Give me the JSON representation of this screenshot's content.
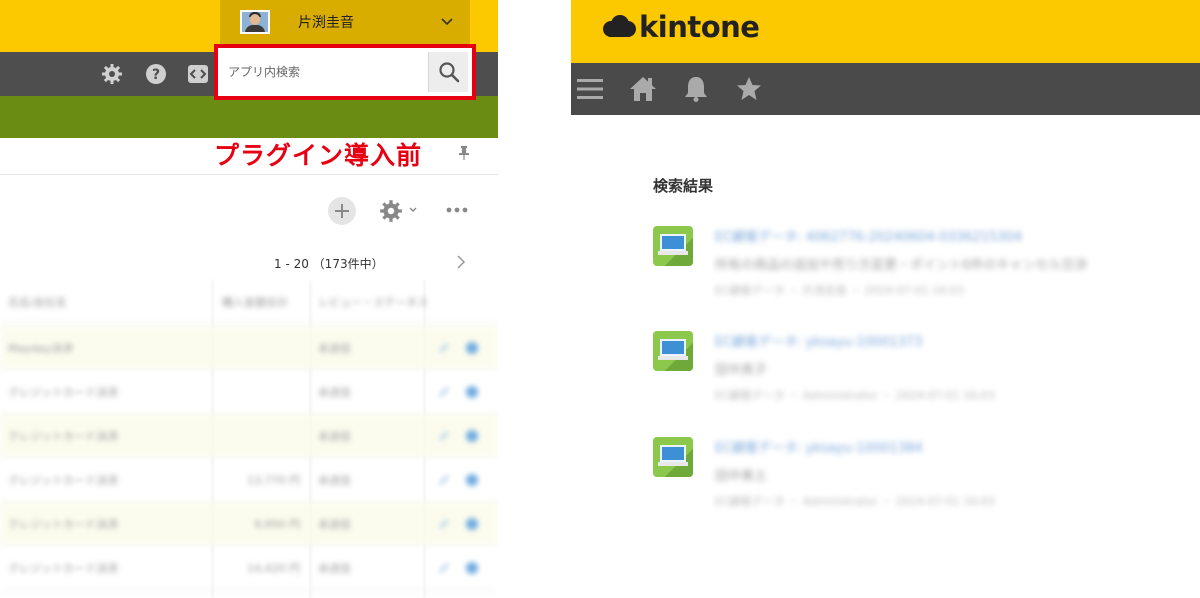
{
  "left_app": {
    "user": {
      "name": "片渕圭音"
    },
    "search": {
      "placeholder": "アプリ内検索"
    },
    "annotation": {
      "label": "プラグイン導入前"
    },
    "toolbar": {
      "pager": "1 - 20 （173件中）"
    },
    "table": {
      "headers": [
        "氏名/会社名",
        "購入金額合計",
        "レビュー・ステータス"
      ],
      "rows": [
        {
          "name": "Mayday決済",
          "amount": "",
          "status": "未送信"
        },
        {
          "name": "クレジットカード決済",
          "amount": "",
          "status": "未送信"
        },
        {
          "name": "クレジットカード決済",
          "amount": "",
          "status": "未送信"
        },
        {
          "name": "クレジットカード決済",
          "amount": "13,770 円",
          "status": "未送信"
        },
        {
          "name": "クレジットカード決済",
          "amount": "9,950 円",
          "status": "未送信"
        },
        {
          "name": "クレジットカード決済",
          "amount": "14,420 円",
          "status": "未送信"
        }
      ]
    },
    "colors": {
      "header_yellow": "#fcc800",
      "user_bar": "#d9ad00",
      "toolbar_gray": "#4e4e4e",
      "app_green": "#6a8c12",
      "annotation_red": "#e60012"
    }
  },
  "right_app": {
    "brand": {
      "logo_text": "kintone"
    },
    "nav_icons": [
      "menu-icon",
      "home-icon",
      "bell-icon",
      "star-icon"
    ],
    "results_title": "検索結果",
    "results": [
      {
        "title": "EC顧客データ: 4062776-20240604-0336215304",
        "subtitle": "所有の商品の追加や売り方変更・ポイント6件のキャンセル交渉",
        "meta": "EC顧客データ ・ 片渕圭音 ・ 2024-07-01 16:03"
      },
      {
        "title": "EC顧客データ: yksayu-10001373",
        "subtitle": "田中真子",
        "meta": "EC顧客データ ・ Administrator ・ 2024-07-01 16:03"
      },
      {
        "title": "EC顧客データ: yksayu-10001384",
        "subtitle": "田中美土",
        "meta": "EC顧客データ ・ Administrator ・ 2024-07-01 16:03"
      }
    ],
    "colors": {
      "header_yellow": "#fcc800",
      "nav_gray": "#4a4a4a",
      "record_icon_green": "#8cc84b",
      "link_blue": "#3f7fc9"
    }
  }
}
